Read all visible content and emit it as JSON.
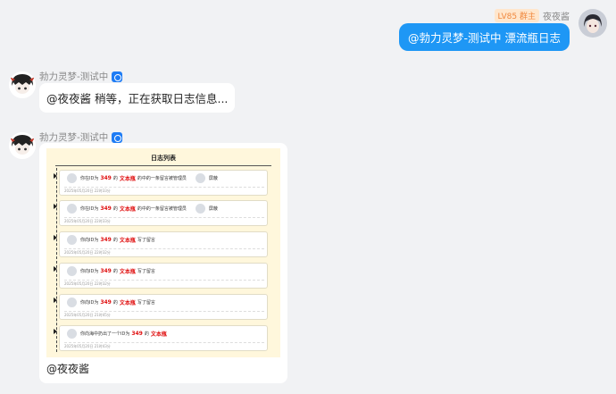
{
  "outgoing": {
    "badge": "LV85 群主",
    "sender": "夜夜酱",
    "text": "@勃力灵梦-测试中 漂流瓶日志"
  },
  "bot": {
    "name": "勃力灵梦-测试中"
  },
  "message1": {
    "text": "@夜夜酱 稍等，正在获取日志信息..."
  },
  "message2": {
    "log_title": "日志列表",
    "entries": [
      {
        "pre": "你在ID为",
        "id": "349",
        "mid": "的",
        "type": "文本瓶",
        "post": "的中的一条留言被管理员",
        "who": "屏蔽",
        "time": "2025年05月20日 22时33分"
      },
      {
        "pre": "你在ID为",
        "id": "349",
        "mid": "的",
        "type": "文本瓶",
        "post": "的中的一条留言被管理员",
        "who": "屏蔽",
        "time": "2025年05月20日 22时33分"
      },
      {
        "pre": "你向ID为",
        "id": "349",
        "mid": "的",
        "type": "文本瓶",
        "post": "写了留言",
        "who": "",
        "time": "2025年05月20日 22时32分"
      },
      {
        "pre": "你向ID为",
        "id": "349",
        "mid": "的",
        "type": "文本瓶",
        "post": "写了留言",
        "who": "",
        "time": "2025年05月20日 22时32分"
      },
      {
        "pre": "你向ID为",
        "id": "349",
        "mid": "的",
        "type": "文本瓶",
        "post": "写了留言",
        "who": "",
        "time": "2025年05月20日 21时45分"
      },
      {
        "pre": "你向海中扔出了一个ID为",
        "id": "349",
        "mid": "的",
        "type": "文本瓶",
        "post": "",
        "who": "",
        "time": "2025年05月20日 21时43分"
      }
    ],
    "footer_text": "@夜夜酱"
  },
  "colors": {
    "outgoing_bubble": "#1e97f5",
    "badge_text": "#f0883e",
    "log_background": "#fff7dc",
    "highlight": "#e01010"
  }
}
